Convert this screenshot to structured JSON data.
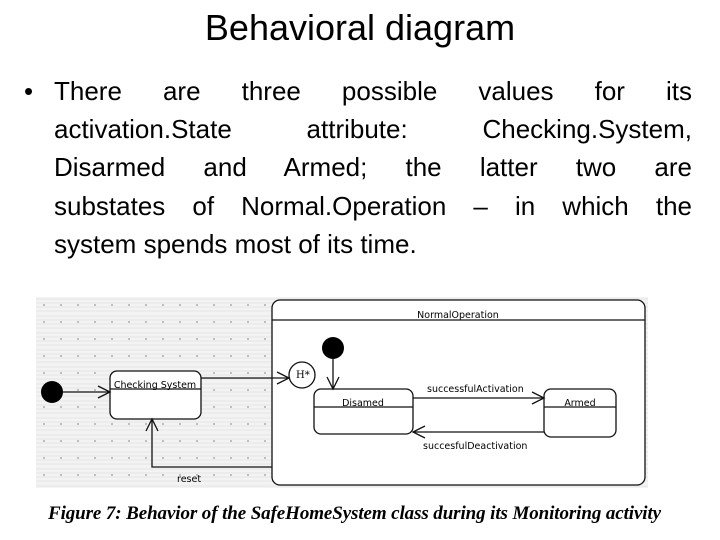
{
  "slide": {
    "title": "Behavioral diagram",
    "bullet_symbol": "•",
    "bullet_lines": [
      "There are three possible values for its",
      "activation.State attribute: Checking.System,",
      "Disarmed and Armed; the latter two are",
      "substates of Normal.Operation – in which the",
      "system spends most of its time."
    ]
  },
  "diagram": {
    "composite_state": "NormalOperation",
    "states": [
      "Checking System",
      "Disamed",
      "Armed"
    ],
    "history": "H*",
    "transitions": {
      "activate": "successfulActivation",
      "deactivate": "succesfulDeactivation",
      "reset": "reset"
    }
  },
  "caption": "Figure 7: Behavior of the SafeHomeSystem class during its Monitoring activity"
}
